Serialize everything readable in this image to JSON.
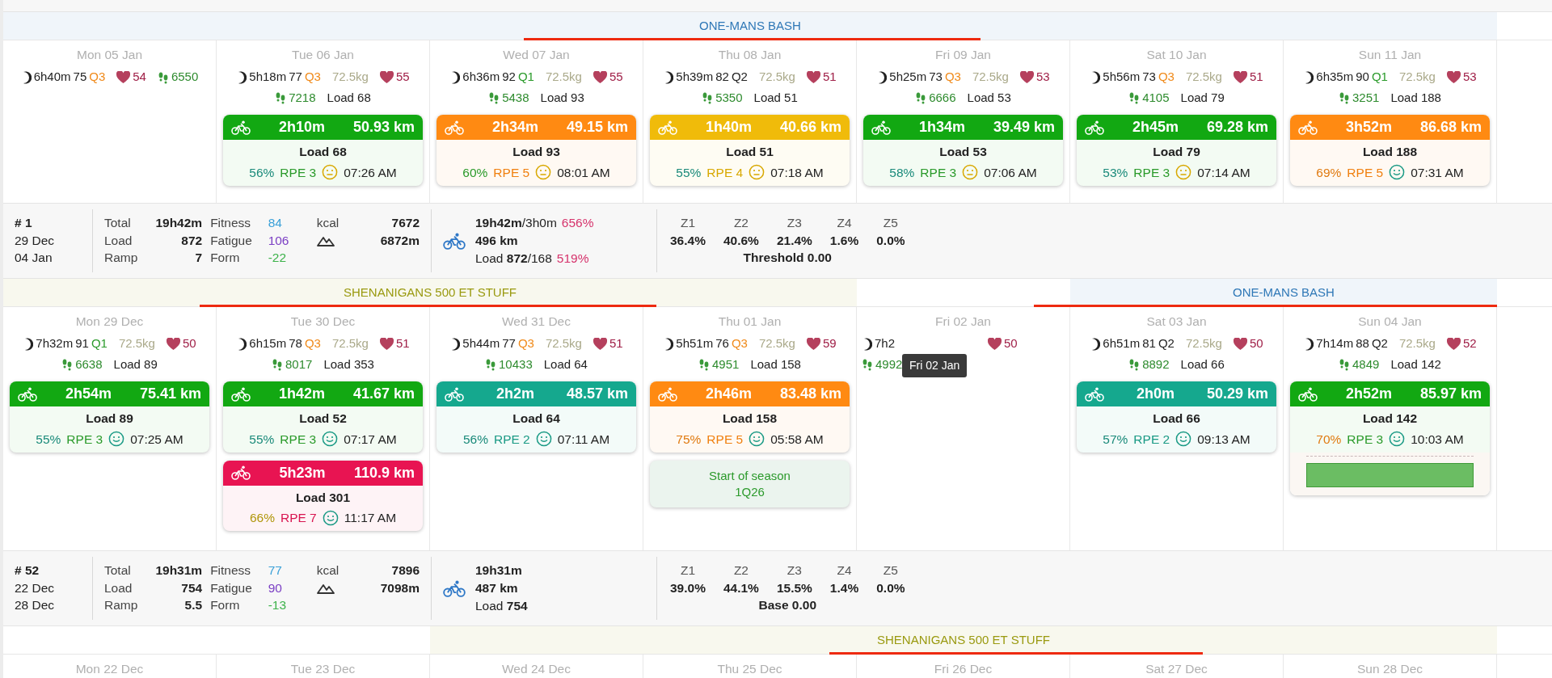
{
  "sections": [
    {
      "banner": [
        {
          "kind": "event",
          "label": "ONE-MANS BASH",
          "color": "#2f78b7"
        }
      ],
      "days": [
        {
          "date": "Mon 05 Jan",
          "sleep": "6h40m",
          "score": "75",
          "quality": {
            "text": "Q3",
            "color": "#f08a1a"
          },
          "hr": "54",
          "steps": "6550"
        },
        {
          "date": "Tue 06 Jan",
          "sleep": "5h18m",
          "score": "77",
          "quality": {
            "text": "Q3",
            "color": "#f08a1a"
          },
          "weight": "72.5kg",
          "hr": "55",
          "steps": "7218",
          "load": "Load 68",
          "activities": [
            {
              "duration": "2h10m",
              "distance": "50.93 km",
              "color": "#12a812",
              "load": "Load 68",
              "pct": {
                "text": "56%",
                "color": "#1a8a7a"
              },
              "rpe": {
                "text": "RPE 3",
                "color": "#2a9a2a"
              },
              "face": {
                "kind": "neutral",
                "color": "#d8a800"
              },
              "time": "07:26 AM"
            }
          ]
        },
        {
          "date": "Wed 07 Jan",
          "sleep": "6h36m",
          "score": "92",
          "quality": {
            "text": "Q1",
            "color": "#2a9a2a"
          },
          "weight": "72.5kg",
          "hr": "55",
          "steps": "5438",
          "load": "Load 93",
          "activities": [
            {
              "duration": "2h34m",
              "distance": "49.15 km",
              "color": "#ff8a12",
              "load": "Load 93",
              "pct": {
                "text": "60%",
                "color": "#2a9a2a"
              },
              "rpe": {
                "text": "RPE 5",
                "color": "#f08010"
              },
              "face": {
                "kind": "neutral",
                "color": "#d8a800"
              },
              "time": "08:01 AM"
            }
          ]
        },
        {
          "date": "Thu 08 Jan",
          "sleep": "5h39m",
          "score": "82",
          "quality": {
            "text": "Q2",
            "color": "#222222"
          },
          "weight": "72.5kg",
          "hr": "51",
          "steps": "5350",
          "load": "Load 51",
          "activities": [
            {
              "duration": "1h40m",
              "distance": "40.66 km",
              "color": "#f0bb0a",
              "load": "Load 51",
              "pct": {
                "text": "55%",
                "color": "#1a8a7a"
              },
              "rpe": {
                "text": "RPE 4",
                "color": "#d8a800"
              },
              "face": {
                "kind": "neutral",
                "color": "#d8a800"
              },
              "time": "07:18 AM"
            }
          ]
        },
        {
          "date": "Fri 09 Jan",
          "sleep": "5h25m",
          "score": "73",
          "quality": {
            "text": "Q3",
            "color": "#f08a1a"
          },
          "weight": "72.5kg",
          "hr": "53",
          "steps": "6666",
          "load": "Load 53",
          "activities": [
            {
              "duration": "1h34m",
              "distance": "39.49 km",
              "color": "#12a812",
              "load": "Load 53",
              "pct": {
                "text": "58%",
                "color": "#1a8a7a"
              },
              "rpe": {
                "text": "RPE 3",
                "color": "#2a9a2a"
              },
              "face": {
                "kind": "neutral",
                "color": "#d8a800"
              },
              "time": "07:06 AM"
            }
          ]
        },
        {
          "date": "Sat 10 Jan",
          "sleep": "5h56m",
          "score": "73",
          "quality": {
            "text": "Q3",
            "color": "#f08a1a"
          },
          "weight": "72.5kg",
          "hr": "51",
          "steps": "4105",
          "load": "Load 79",
          "activities": [
            {
              "duration": "2h45m",
              "distance": "69.28 km",
              "color": "#12a812",
              "load": "Load 79",
              "pct": {
                "text": "53%",
                "color": "#1a8a7a"
              },
              "rpe": {
                "text": "RPE 3",
                "color": "#2a9a2a"
              },
              "face": {
                "kind": "neutral",
                "color": "#d8a800"
              },
              "time": "07:14 AM"
            }
          ]
        },
        {
          "date": "Sun 11 Jan",
          "sleep": "6h35m",
          "score": "90",
          "quality": {
            "text": "Q1",
            "color": "#2a9a2a"
          },
          "weight": "72.5kg",
          "hr": "53",
          "steps": "3251",
          "load": "Load 188",
          "activities": [
            {
              "duration": "3h52m",
              "distance": "86.68 km",
              "color": "#ff8a12",
              "load": "Load 188",
              "pct": {
                "text": "69%",
                "color": "#e07a10"
              },
              "rpe": {
                "text": "RPE 5",
                "color": "#f08010"
              },
              "face": {
                "kind": "smile",
                "color": "#1a9a85"
              },
              "time": "07:31 AM"
            }
          ]
        }
      ],
      "summary": {
        "week": "# 1",
        "start": "29 Dec",
        "end": "04 Jan",
        "stats": [
          {
            "label": "Total",
            "value": "19h42m"
          },
          {
            "label": "Load",
            "value": "872"
          },
          {
            "label": "Ramp",
            "value": "7"
          }
        ],
        "fitness": [
          {
            "label": "Fitness",
            "value": "84",
            "color": "#3aa0d8"
          },
          {
            "label": "Fatigue",
            "value": "106",
            "color": "#7b3fc4"
          },
          {
            "label": "Form",
            "value": "-22",
            "color": "#3cb24a"
          }
        ],
        "kcal_label": "kcal",
        "kcal": "7672",
        "climb": "6872m",
        "ride": [
          {
            "text": "**19h42m**/3h0m",
            "bold": false,
            "pct": "656%"
          },
          {
            "text": "496 km",
            "bold": true
          },
          {
            "text": "Load **872**/168",
            "bold": false,
            "pct": "519%"
          }
        ],
        "zones": [
          {
            "label": "Z1",
            "value": "36.4%"
          },
          {
            "label": "Z2",
            "value": "40.6%"
          },
          {
            "label": "Z3",
            "value": "21.4%"
          },
          {
            "label": "Z4",
            "value": "1.6%"
          },
          {
            "label": "Z5",
            "value": "0.0%"
          }
        ],
        "zone_note": "Threshold 0.00"
      }
    },
    {
      "banner": [
        {
          "kind": "event",
          "label": "SHENANIGANS 500 ET STUFF",
          "color": "#9a9a10"
        },
        {
          "kind": "gap"
        },
        {
          "kind": "event",
          "label": "ONE-MANS BASH",
          "color": "#2f78b7"
        }
      ],
      "days": [
        {
          "date": "Mon 29 Dec",
          "sleep": "7h32m",
          "score": "91",
          "quality": {
            "text": "Q1",
            "color": "#2a9a2a"
          },
          "weight": "72.5kg",
          "hr": "50",
          "steps": "6638",
          "load": "Load 89",
          "activities": [
            {
              "duration": "2h54m",
              "distance": "75.41 km",
              "color": "#12a812",
              "load": "Load 89",
              "pct": {
                "text": "55%",
                "color": "#1a8a7a"
              },
              "rpe": {
                "text": "RPE 3",
                "color": "#2a9a2a"
              },
              "face": {
                "kind": "smile",
                "color": "#1a9a85"
              },
              "time": "07:25 AM"
            }
          ]
        },
        {
          "date": "Tue 30 Dec",
          "sleep": "6h15m",
          "score": "78",
          "quality": {
            "text": "Q3",
            "color": "#f08a1a"
          },
          "weight": "72.5kg",
          "hr": "51",
          "steps": "8017",
          "load": "Load 353",
          "activities": [
            {
              "duration": "1h42m",
              "distance": "41.67 km",
              "color": "#12a812",
              "load": "Load 52",
              "pct": {
                "text": "55%",
                "color": "#1a8a7a"
              },
              "rpe": {
                "text": "RPE 3",
                "color": "#2a9a2a"
              },
              "face": {
                "kind": "smile",
                "color": "#1a9a85"
              },
              "time": "07:17 AM"
            },
            {
              "duration": "5h23m",
              "distance": "110.9 km",
              "color": "#e81452",
              "load": "Load 301",
              "pct": {
                "text": "66%",
                "color": "#b0960a"
              },
              "rpe": {
                "text": "RPE 7",
                "color": "#d81450"
              },
              "face": {
                "kind": "smile",
                "color": "#1a9a85"
              },
              "time": "11:17 AM"
            }
          ]
        },
        {
          "date": "Wed 31 Dec",
          "sleep": "5h44m",
          "score": "77",
          "quality": {
            "text": "Q3",
            "color": "#f08a1a"
          },
          "weight": "72.5kg",
          "hr": "51",
          "steps": "10433",
          "load": "Load 64",
          "activities": [
            {
              "duration": "2h2m",
              "distance": "48.57 km",
              "color": "#15a88e",
              "load": "Load 64",
              "pct": {
                "text": "56%",
                "color": "#1a8a7a"
              },
              "rpe": {
                "text": "RPE 2",
                "color": "#1a9a85"
              },
              "face": {
                "kind": "smile",
                "color": "#1a9a85"
              },
              "time": "07:11 AM"
            }
          ]
        },
        {
          "date": "Thu 01 Jan",
          "sleep": "5h51m",
          "score": "76",
          "quality": {
            "text": "Q3",
            "color": "#f08a1a"
          },
          "weight": "72.5kg",
          "hr": "59",
          "steps": "4951",
          "load": "Load 158",
          "activities": [
            {
              "duration": "2h46m",
              "distance": "83.48 km",
              "color": "#ff8a12",
              "load": "Load 158",
              "pct": {
                "text": "75%",
                "color": "#e07a10"
              },
              "rpe": {
                "text": "RPE 5",
                "color": "#f08010"
              },
              "face": {
                "kind": "smile",
                "color": "#1a9a85"
              },
              "time": "05:58 AM"
            }
          ],
          "note": [
            "Start of season",
            "1Q26"
          ]
        },
        {
          "date": "Fri 02 Jan",
          "sleep": "7h2",
          "hr": "50",
          "steps": "4992",
          "tooltip": "Fri 02 Jan"
        },
        {
          "date": "Sat 03 Jan",
          "sleep": "6h51m",
          "score": "81",
          "quality": {
            "text": "Q2",
            "color": "#222222"
          },
          "weight": "72.5kg",
          "hr": "50",
          "steps": "8892",
          "load": "Load 66",
          "activities": [
            {
              "duration": "2h0m",
              "distance": "50.29 km",
              "color": "#15a88e",
              "load": "Load 66",
              "pct": {
                "text": "57%",
                "color": "#1a8a7a"
              },
              "rpe": {
                "text": "RPE 2",
                "color": "#1a9a85"
              },
              "face": {
                "kind": "smile",
                "color": "#1a9a85"
              },
              "time": "09:13 AM"
            }
          ]
        },
        {
          "date": "Sun 04 Jan",
          "sleep": "7h14m",
          "score": "88",
          "quality": {
            "text": "Q2",
            "color": "#222222"
          },
          "weight": "72.5kg",
          "hr": "52",
          "steps": "4849",
          "load": "Load 142",
          "activities": [
            {
              "duration": "2h52m",
              "distance": "85.97 km",
              "color": "#12a812",
              "load": "Load 142",
              "pct": {
                "text": "70%",
                "color": "#e07a10"
              },
              "rpe": {
                "text": "RPE 3",
                "color": "#2a9a2a"
              },
              "face": {
                "kind": "smile",
                "color": "#1a9a85"
              },
              "time": "10:03 AM",
              "planned": true
            }
          ]
        }
      ],
      "summary": {
        "week": "# 52",
        "start": "22 Dec",
        "end": "28 Dec",
        "stats": [
          {
            "label": "Total",
            "value": "19h31m"
          },
          {
            "label": "Load",
            "value": "754"
          },
          {
            "label": "Ramp",
            "value": "5.5"
          }
        ],
        "fitness": [
          {
            "label": "Fitness",
            "value": "77",
            "color": "#3aa0d8"
          },
          {
            "label": "Fatigue",
            "value": "90",
            "color": "#7b3fc4"
          },
          {
            "label": "Form",
            "value": "-13",
            "color": "#3cb24a"
          }
        ],
        "kcal_label": "kcal",
        "kcal": "7896",
        "climb": "7098m",
        "ride": [
          {
            "text": "19h31m",
            "bold": true
          },
          {
            "text": "487 km",
            "bold": true
          },
          {
            "text": "Load **754**",
            "bold": false
          }
        ],
        "zones": [
          {
            "label": "Z1",
            "value": "39.0%"
          },
          {
            "label": "Z2",
            "value": "44.1%"
          },
          {
            "label": "Z3",
            "value": "15.5%"
          },
          {
            "label": "Z4",
            "value": "1.4%"
          },
          {
            "label": "Z5",
            "value": "0.0%"
          }
        ],
        "zone_note": "Base 0.00"
      }
    },
    {
      "banner": [
        {
          "kind": "gap"
        },
        {
          "kind": "event",
          "label": "SHENANIGANS 500 ET STUFF",
          "color": "#9a9a10"
        }
      ],
      "days": [
        {
          "date": "Mon 22 Dec"
        },
        {
          "date": "Tue 23 Dec"
        },
        {
          "date": "Wed 24 Dec"
        },
        {
          "date": "Thu 25 Dec"
        },
        {
          "date": "Fri 26 Dec"
        },
        {
          "date": "Sat 27 Dec"
        },
        {
          "date": "Sun 28 Dec"
        }
      ]
    }
  ]
}
